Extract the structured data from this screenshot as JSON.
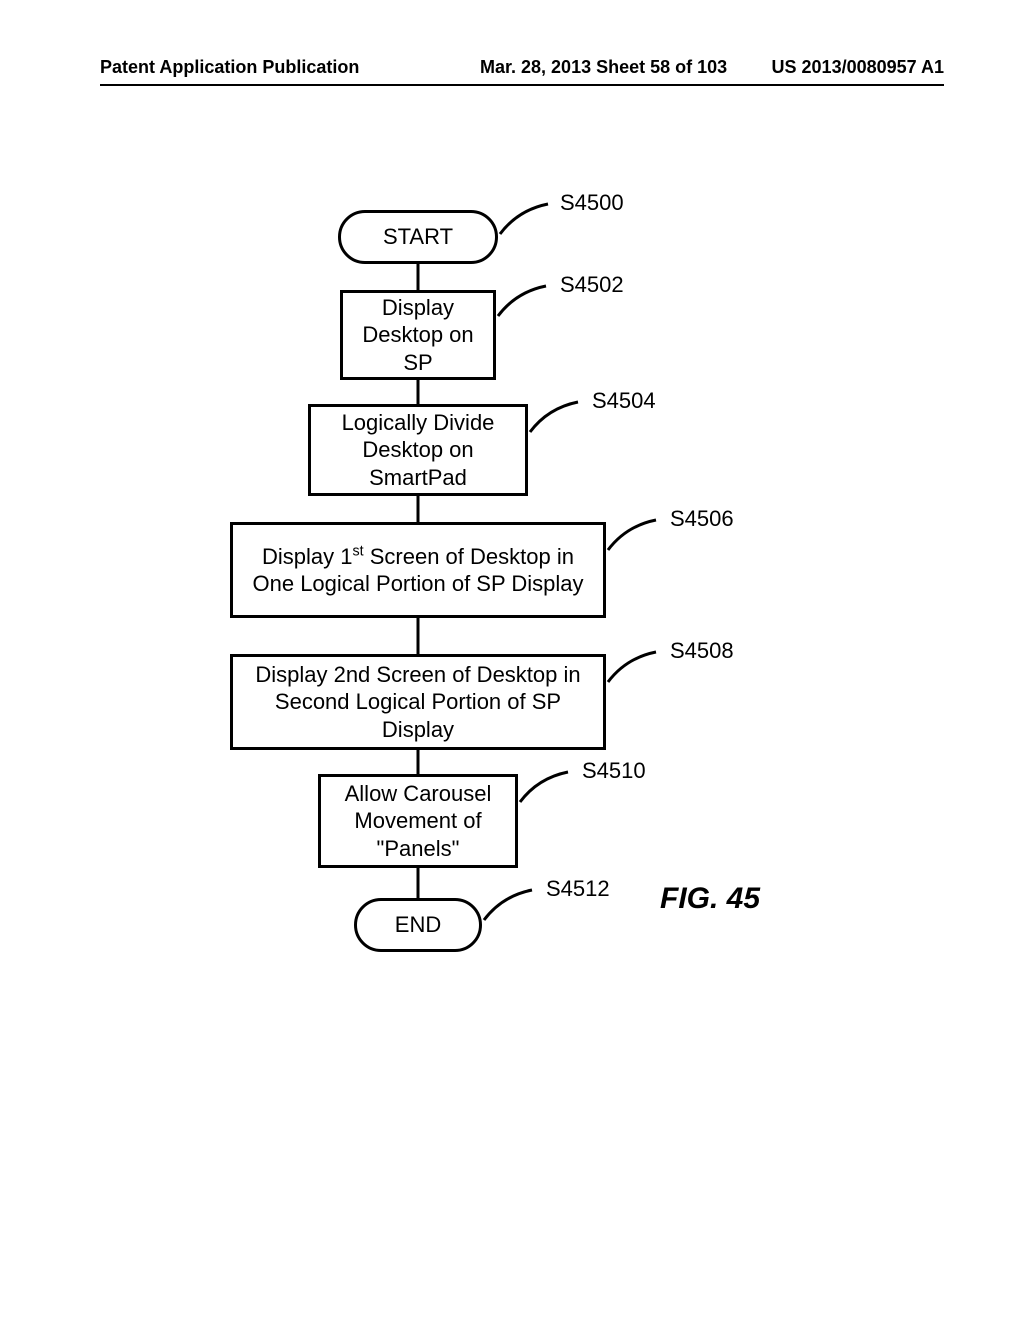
{
  "header": {
    "left": "Patent Application Publication",
    "center": "Mar. 28, 2013  Sheet 58 of 103",
    "right": "US 2013/0080957 A1"
  },
  "flowchart": {
    "nodes": [
      {
        "id": "start",
        "text": "START",
        "ref": "S4500"
      },
      {
        "id": "n1",
        "text": "Display Desktop on SP",
        "ref": "S4502"
      },
      {
        "id": "n2",
        "text": "Logically Divide Desktop on SmartPad",
        "ref": "S4504"
      },
      {
        "id": "n3",
        "text_html": "Display 1<sup>st</sup> Screen of Desktop in One Logical Portion of SP Display",
        "ref": "S4506"
      },
      {
        "id": "n4",
        "text": "Display 2nd Screen of Desktop in Second Logical Portion of SP Display",
        "ref": "S4508"
      },
      {
        "id": "n5",
        "text": "Allow Carousel Movement of \"Panels\"",
        "ref": "S4510"
      },
      {
        "id": "end",
        "text": "END",
        "ref": "S4512"
      }
    ],
    "figure_label": "FIG. 45"
  }
}
